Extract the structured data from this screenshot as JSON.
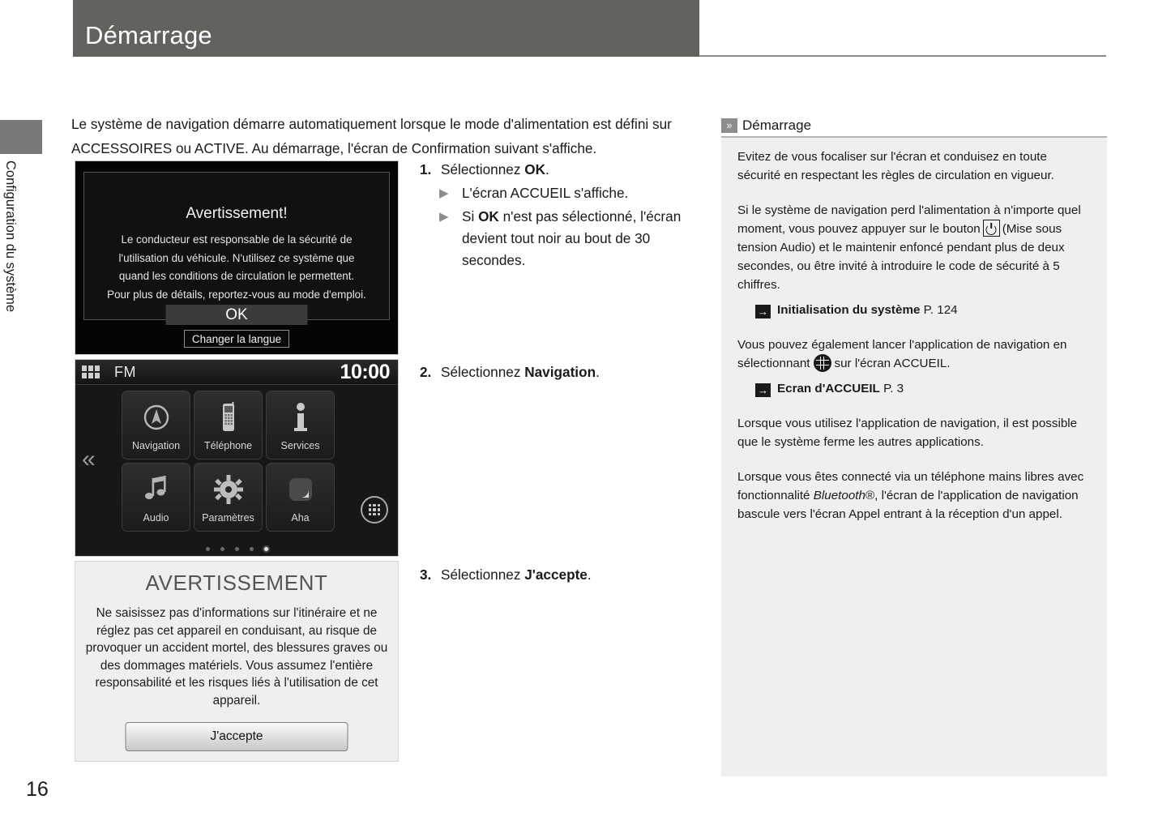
{
  "header": {
    "title": "Démarrage"
  },
  "side_tab": {
    "label": "Configuration du système"
  },
  "page_number": "16",
  "intro": "Le système de navigation démarre automatiquement lorsque le mode d'alimentation est défini sur ACCESSOIRES ou ACTIVE. Au démarrage, l'écran de Confirmation suivant s'affiche.",
  "figure_warning": {
    "title": "Avertissement!",
    "body": "Le conducteur est responsable de la sécurité de l'utilisation du véhicule. N'utilisez ce système que quand les conditions de circulation le permettent. Pour plus de détails, reportez-vous au mode d'emploi.",
    "ok_label": "OK",
    "language_label": "Changer la langue"
  },
  "figure_home": {
    "source_label": "FM",
    "clock": "10:00",
    "grid_icon": "apps-grid-icon",
    "back_icon": "double-chevron-left-icon",
    "apps_icon": "apps-drawer-icon",
    "tiles": [
      {
        "label": "Navigation",
        "icon": "compass-icon"
      },
      {
        "label": "Téléphone",
        "icon": "phone-icon"
      },
      {
        "label": "Services",
        "icon": "information-icon"
      },
      {
        "label": "Audio",
        "icon": "music-note-icon"
      },
      {
        "label": "Paramètres",
        "icon": "gear-icon"
      },
      {
        "label": "Aha",
        "icon": "aha-app-icon"
      }
    ],
    "page_dots": 5,
    "active_dot": 5
  },
  "figure_accept": {
    "title": "AVERTISSEMENT",
    "body": "Ne saisissez pas d'informations sur l'itinéraire et ne réglez pas cet appareil en conduisant, au risque de provoquer un accident mortel, des blessures graves ou des dommages matériels. Vous assumez l'entière responsabilité et les risques liés à l'utilisation de cet appareil.",
    "accept_label": "J'accepte"
  },
  "steps": {
    "step1": {
      "number": "1.",
      "text_prefix": "Sélectionnez ",
      "text_bold": "OK",
      "text_suffix": ".",
      "bullets": [
        {
          "prefix": "L'écran ACCUEIL s'affiche.",
          "bold": "",
          "suffix": ""
        },
        {
          "prefix": "Si ",
          "bold": "OK",
          "suffix": " n'est pas sélectionné, l'écran devient tout noir au bout de 30 secondes."
        }
      ]
    },
    "step2": {
      "number": "2.",
      "text_prefix": "Sélectionnez ",
      "text_bold": "Navigation",
      "text_suffix": "."
    },
    "step3": {
      "number": "3.",
      "text_prefix": "Sélectionnez ",
      "text_bold": "J'accepte",
      "text_suffix": "."
    }
  },
  "info_panel": {
    "heading": "Démarrage",
    "heading_icon": "double-chevron-right-icon",
    "p1": "Evitez de vous focaliser sur l'écran et conduisez en toute sécurité en respectant les règles de circulation en vigueur.",
    "p2_a": "Si le système de navigation perd l'alimentation à n'importe quel moment, vous pouvez appuyer sur le bouton",
    "p2_b": "(Mise sous tension Audio) et le maintenir enfoncé pendant plus de deux secondes, ou être invité à introduire le code de sécurité à 5 chiffres.",
    "ref1_title": "Initialisation du système",
    "ref1_page": "P. 124",
    "p3_a": "Vous pouvez également lancer l'application de navigation en sélectionnant",
    "p3_b": "sur l'écran ACCUEIL.",
    "ref2_title": "Ecran d'ACCUEIL",
    "ref2_page": "P. 3",
    "p4": "Lorsque vous utilisez l'application de navigation, il est possible que le système ferme les autres applications.",
    "p5_a": "Lorsque vous êtes connecté via un téléphone mains libres avec fonctionnalité",
    "p5_bt": "Bluetooth",
    "p5_b": "®, l'écran de l'application de navigation bascule vers l'écran Appel entrant à la réception d'un appel."
  },
  "colors": {
    "header_bg": "#63625f",
    "panel_bg": "#efefed",
    "screen_dark": "#171717",
    "accent_text": "#1a1a1a"
  }
}
